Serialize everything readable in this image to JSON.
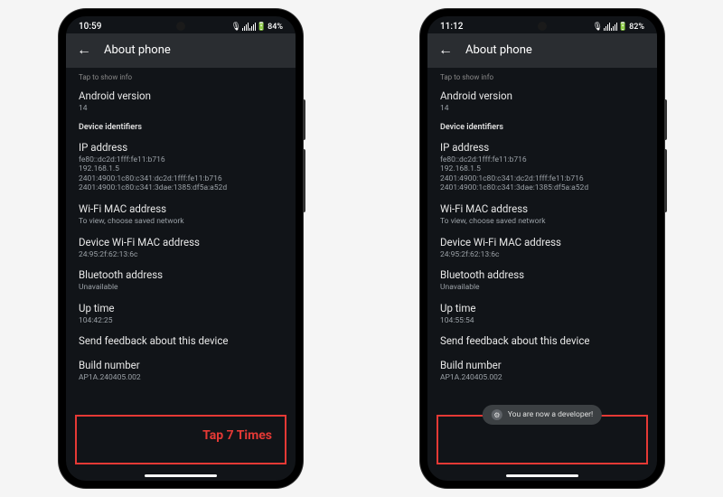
{
  "left": {
    "time": "10:59",
    "battery": "84%",
    "header_title": "About phone",
    "tap_hint": "Tap to show info",
    "android_version_label": "Android version",
    "android_version_value": "14",
    "section_identifiers": "Device identifiers",
    "ip_label": "IP address",
    "ip_line1": "fe80::dc2d:1fff:fe11:b716",
    "ip_line2": "192.168.1.5",
    "ip_line3": "2401:4900:1c80:c341:dc2d:1fff:fe11:b716",
    "ip_line4": "2401:4900:1c80:c341:3dae:1385:df5a:a52d",
    "wifi_mac_label": "Wi-Fi MAC address",
    "wifi_mac_value": "To view, choose saved network",
    "device_wifi_mac_label": "Device Wi-Fi MAC address",
    "device_wifi_mac_value": "24:95:2f:62:13:6c",
    "bt_label": "Bluetooth address",
    "bt_value": "Unavailable",
    "uptime_label": "Up time",
    "uptime_value": "104:42:25",
    "feedback": "Send feedback about this device",
    "build_label": "Build number",
    "build_value": "AP1A.240405.002",
    "tap_instruction": "Tap 7 Times"
  },
  "right": {
    "time": "11:12",
    "battery": "82%",
    "header_title": "About phone",
    "tap_hint": "Tap to show info",
    "android_version_label": "Android version",
    "android_version_value": "14",
    "section_identifiers": "Device identifiers",
    "ip_label": "IP address",
    "ip_line1": "fe80::dc2d:1fff:fe11:b716",
    "ip_line2": "192.168.1.5",
    "ip_line3": "2401:4900:1c80:c341:dc2d:1fff:fe11:b716",
    "ip_line4": "2401:4900:1c80:c341:3dae:1385:df5a:a52d",
    "wifi_mac_label": "Wi-Fi MAC address",
    "wifi_mac_value": "To view, choose saved network",
    "device_wifi_mac_label": "Device Wi-Fi MAC address",
    "device_wifi_mac_value": "24:95:2f:62:13:6c",
    "bt_label": "Bluetooth address",
    "bt_value": "Unavailable",
    "uptime_label": "Up time",
    "uptime_value": "104:55:54",
    "feedback": "Send feedback about this device",
    "build_label": "Build number",
    "build_value": "AP1A.240405.002",
    "toast_message": "You are now a developer!"
  }
}
